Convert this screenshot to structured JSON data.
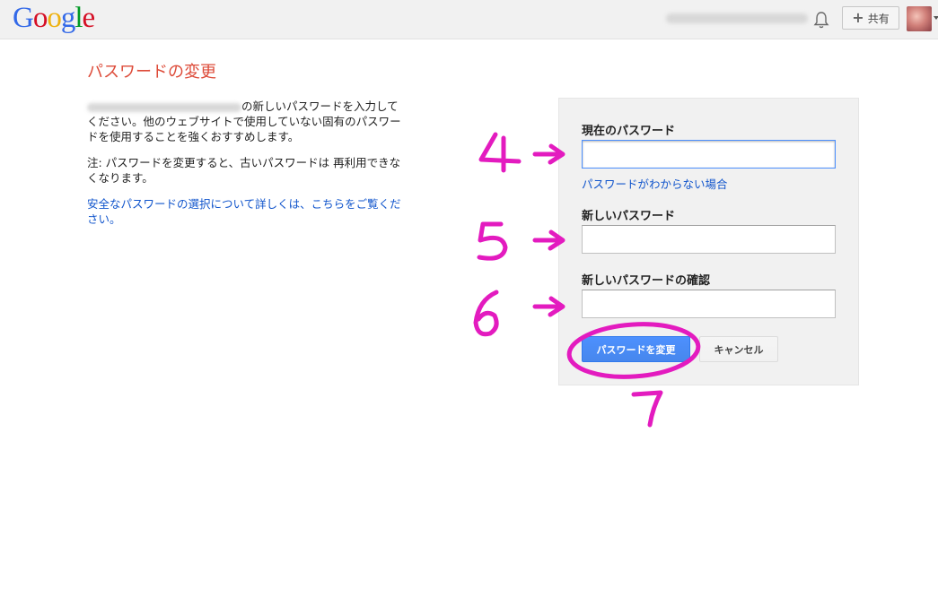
{
  "header": {
    "logo_letters": [
      {
        "ch": "G",
        "color": "#3369e8"
      },
      {
        "ch": "o",
        "color": "#d50f25"
      },
      {
        "ch": "o",
        "color": "#eeb211"
      },
      {
        "ch": "g",
        "color": "#3369e8"
      },
      {
        "ch": "l",
        "color": "#009925"
      },
      {
        "ch": "e",
        "color": "#d50f25"
      }
    ],
    "share_label": "共有",
    "icons": [
      "bell-icon",
      "plus-icon",
      "avatar"
    ]
  },
  "main": {
    "title": "パスワードの変更",
    "desc_part1": "の新しいパスワードを入力してください。他のウェブサイトで使用していない固有のパスワードを使用することを強くおすすめします。",
    "note": "注: パスワードを変更すると、古いパスワードは 再利用できなくなります。",
    "learn_more_link": "安全なパスワードの選択について詳しくは、こちらをご覧ください。"
  },
  "form": {
    "current_password_label": "現在のパスワード",
    "forgot_link": "パスワードがわからない場合",
    "new_password_label": "新しいパスワード",
    "confirm_password_label": "新しいパスワードの確認",
    "submit_label": "パスワードを変更",
    "cancel_label": "キャンセル"
  },
  "annotations": {
    "color": "#e31bbf",
    "numbers": [
      "4",
      "5",
      "6",
      "7"
    ]
  }
}
